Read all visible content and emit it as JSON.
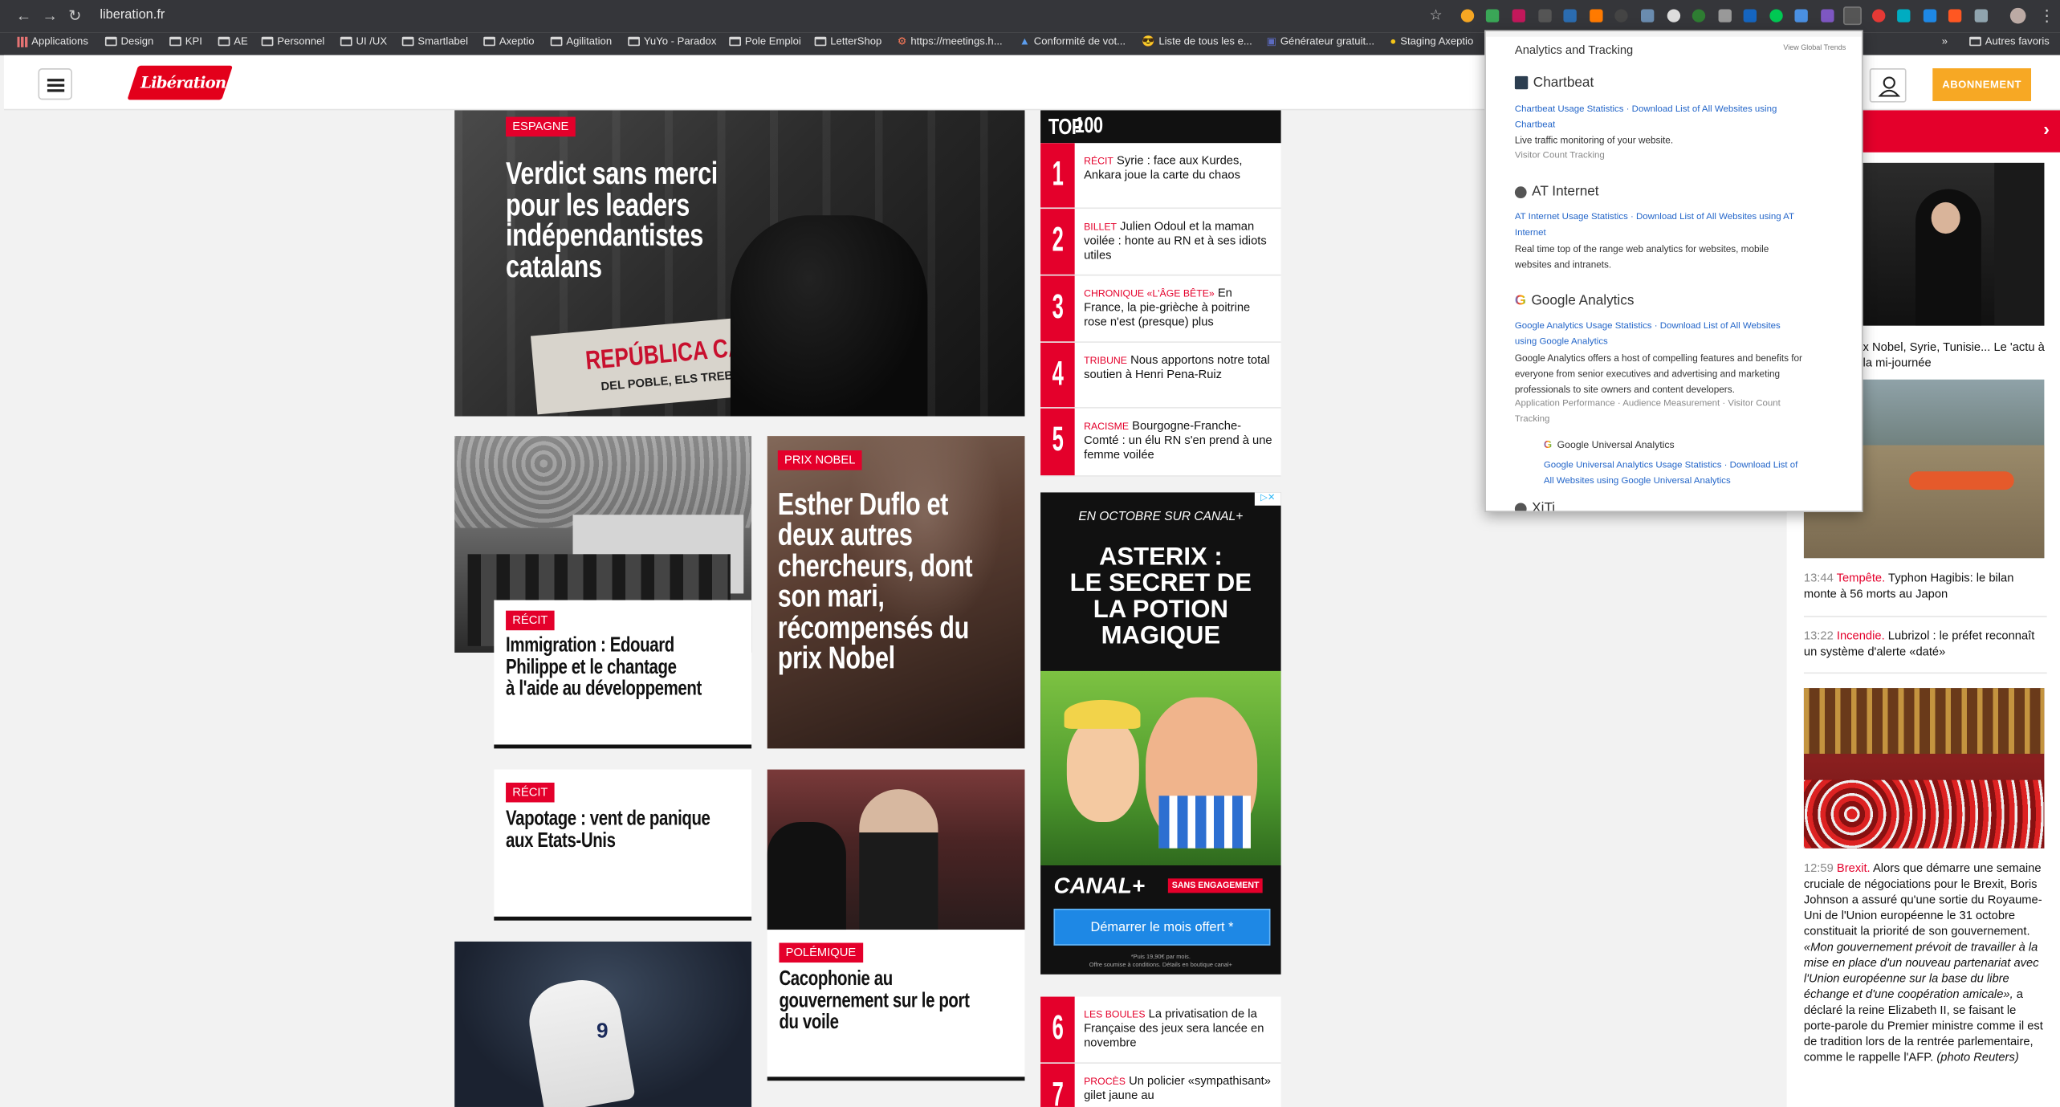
{
  "browser": {
    "url": "liberation.fr",
    "bookmarks": [
      "Applications",
      "Design",
      "KPI",
      "AE",
      "Personnel",
      "UI /UX",
      "Smartlabel",
      "Axeptio",
      "Agilitation",
      "YuYo - Paradox",
      "Pole Emploi",
      "LetterShop",
      "https://meetings.h...",
      "Conformité de vot...",
      "Liste de tous les e...",
      "Générateur gratuit...",
      "Staging Axeptio"
    ],
    "other_bookmarks": "Autres favoris"
  },
  "header": {
    "logo": "Libération",
    "subscribe": "ABONNEMENT"
  },
  "hero": {
    "tag": "ESPAGNE",
    "title_lines": [
      "Verdict sans merci",
      "pour les leaders",
      "indépendantistes",
      "catalans"
    ],
    "banner_text": "REPÚBLICA CATA",
    "banner_sub": "DEL POBLE, ELS TREBALLADORS"
  },
  "cards": {
    "immigration": {
      "tag": "RÉCIT",
      "title_lines": [
        "Immigration : Edouard",
        "Philippe et le chantage",
        "à l'aide au développement"
      ]
    },
    "nobel": {
      "tag": "PRIX NOBEL",
      "title_lines": [
        "Esther Duflo et",
        "deux autres",
        "chercheurs, dont",
        "son mari,",
        "récompensés du",
        "prix Nobel"
      ]
    },
    "vapotage": {
      "tag": "RÉCIT",
      "title_lines": [
        "Vapotage : vent de panique",
        "aux Etats-Unis"
      ]
    },
    "cacophonie": {
      "tag": "POLÉMIQUE",
      "title_lines": [
        "Cacophonie au",
        "gouvernement sur le port",
        "du voile"
      ]
    }
  },
  "top100": {
    "title": "TOP",
    "title_num": "100",
    "items": [
      {
        "num": "1",
        "kicker": "RÉCIT",
        "text": "Syrie : face aux Kurdes, Ankara joue la carte du chaos"
      },
      {
        "num": "2",
        "kicker": "BILLET",
        "text": "Julien Odoul et la maman voilée : honte au RN et à ses idiots utiles"
      },
      {
        "num": "3",
        "kicker": "CHRONIQUE «L'ÂGE BÊTE»",
        "text": "En France, la pie-grièche à poitrine rose n'est (presque) plus"
      },
      {
        "num": "4",
        "kicker": "TRIBUNE",
        "text": "Nous apportons notre total soutien à Henri Pena-Ruiz"
      },
      {
        "num": "5",
        "kicker": "RACISME",
        "text": "Bourgogne-Franche-Comté : un élu RN s'en prend à une femme voilée"
      },
      {
        "num": "6",
        "kicker": "LES BOULES",
        "text": "La privatisation de la Française des jeux sera lancée en novembre"
      },
      {
        "num": "7",
        "kicker": "PROCÈS",
        "text": "Un policier «sympathisant» gilet jaune au"
      }
    ]
  },
  "ad": {
    "top": "EN OCTOBRE SUR CANAL+",
    "title_lines": [
      "ASTERIX :",
      "LE SECRET DE",
      "LA POTION",
      "MAGIQUE"
    ],
    "brand": "CANAL+",
    "badge": "SANS ENGAGEMENT",
    "cta": "Démarrer le mois offert *",
    "fine_lines": [
      "*Puis 19,90€ par mois.",
      "Offre soumise à conditions. Détails en boutique canal+"
    ]
  },
  "right": {
    "item_top": "x Nobel, Syrie, Tunisie... Le 'actu à la mi-journée",
    "items": [
      {
        "time": "13:44",
        "kicker": "Tempête.",
        "text": "Typhon Hagibis: le bilan monte à 56 morts au Japon"
      },
      {
        "time": "13:22",
        "kicker": "Incendie.",
        "text": "Lubrizol : le préfet reconnaît un système d'alerte «daté»"
      }
    ],
    "brexit": {
      "time": "12:59",
      "kicker": "Brexit.",
      "text": "Alors que démarre une semaine cruciale de négociations pour le Brexit, Boris Johnson a assuré qu'une sortie du Royaume-Uni de l'Union européenne le 31 octobre constituait la priorité de son gouvernement.",
      "quote": "«Mon gouvernement prévoit de travailler à la mise en place d'un nouveau partenariat avec l'Union européenne sur la base du libre échange et d'une coopération amicale»,",
      "tail": "a déclaré la reine Elizabeth II, se faisant le porte-parole du Premier ministre comme il est de tradition lors de la rentrée parlementaire, comme le rappelle l'AFP.",
      "credit": "(photo Reuters)"
    }
  },
  "popup": {
    "title": "Analytics and Tracking",
    "global": "View Global Trends",
    "chartbeat": {
      "name": "Chartbeat",
      "links": "Chartbeat Usage Statistics · Download List of All Websites using",
      "links2": "Chartbeat",
      "desc": "Live traffic monitoring of your website.",
      "sub": "Visitor Count Tracking"
    },
    "atinternet": {
      "name": "AT Internet",
      "links": "AT Internet Usage Statistics · Download List of All Websites using AT",
      "links2": "Internet",
      "desc1": "Real time top of the range web analytics for websites, mobile",
      "desc2": "websites and intranets."
    },
    "ga": {
      "name": "Google Analytics",
      "links": "Google Analytics Usage Statistics · Download List of All Websites",
      "links2": "using Google Analytics",
      "desc1": "Google Analytics offers a host of compelling features and benefits for",
      "desc2": "everyone from senior executives and advertising and marketing",
      "desc3": "professionals to site owners and content developers.",
      "sub1": "Application Performance · Audience Measurement · Visitor Count",
      "sub2": "Tracking"
    },
    "gua": {
      "name": "Google Universal Analytics",
      "links": "Google Universal Analytics Usage Statistics · Download List of",
      "links2": "All Websites using Google Universal Analytics"
    },
    "xiti": {
      "name": "XiTi"
    }
  }
}
